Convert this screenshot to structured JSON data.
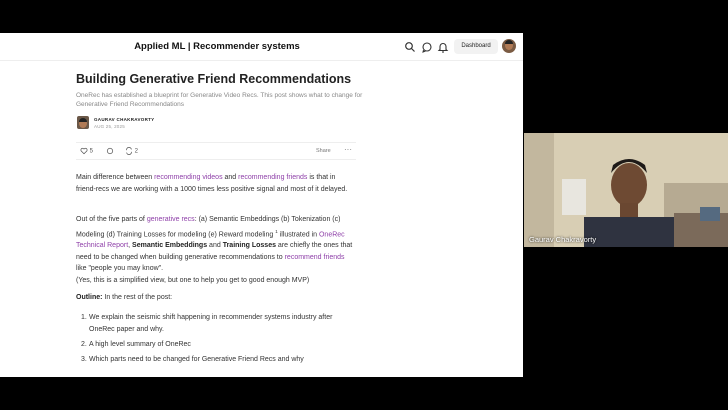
{
  "header": {
    "publication": "Applied ML | Recommender systems",
    "dashboard_label": "Dashboard"
  },
  "post": {
    "title": "Building Generative Friend Recommendations",
    "subtitle": "OneRec has established a blueprint for Generative Video Recs. This post shows what to change for Generative Friend Recommendations",
    "author": "GAURAV CHAKRAVORTY",
    "date": "AUG 25, 2025"
  },
  "actions": {
    "likes": "5",
    "restacks": "2",
    "share_label": "Share",
    "more_label": "···"
  },
  "body": {
    "p1_a": "Main difference between ",
    "p1_link1": "recommending videos",
    "p1_b": " and ",
    "p1_link2": "recommending friends",
    "p1_c": " is that in friend-recs we are working with a 1000 times less positive signal and most of it delayed.",
    "p2_a": "Out of the five parts of ",
    "p2_link1": "generative recs",
    "p2_b": ": (a) Semantic Embeddings (b) Tokenization (c) Modeling (d) Training Losses for modeling (e) Reward modeling ",
    "p2_sup": "1",
    "p2_c": " illustrated in ",
    "p2_link2": "OneRec Technical Report",
    "p2_d": ", ",
    "p2_bold1": "Semantic Embeddings",
    "p2_e": " and ",
    "p2_bold2": "Training Losses",
    "p2_f": " are chiefly the ones that need to be changed when building generative recommendations to ",
    "p2_link3": "recommend friends",
    "p2_g": " like \"people you may know\".",
    "p2_note": "(Yes, this is a simplified view, but one to help you get to good enough MVP)",
    "outline_label": "Outline:",
    "outline_rest": " In the rest of the post:",
    "outline_items": [
      "We explain the seismic shift happening in recommender systems industry after OneRec paper and why.",
      "A high level summary of OneRec",
      "Which parts need to be changed for Generative Friend Recs and why"
    ],
    "outline_nums": [
      "1.",
      "2.",
      "3."
    ]
  },
  "webcam": {
    "name": "Gaurav Chakravorty"
  }
}
